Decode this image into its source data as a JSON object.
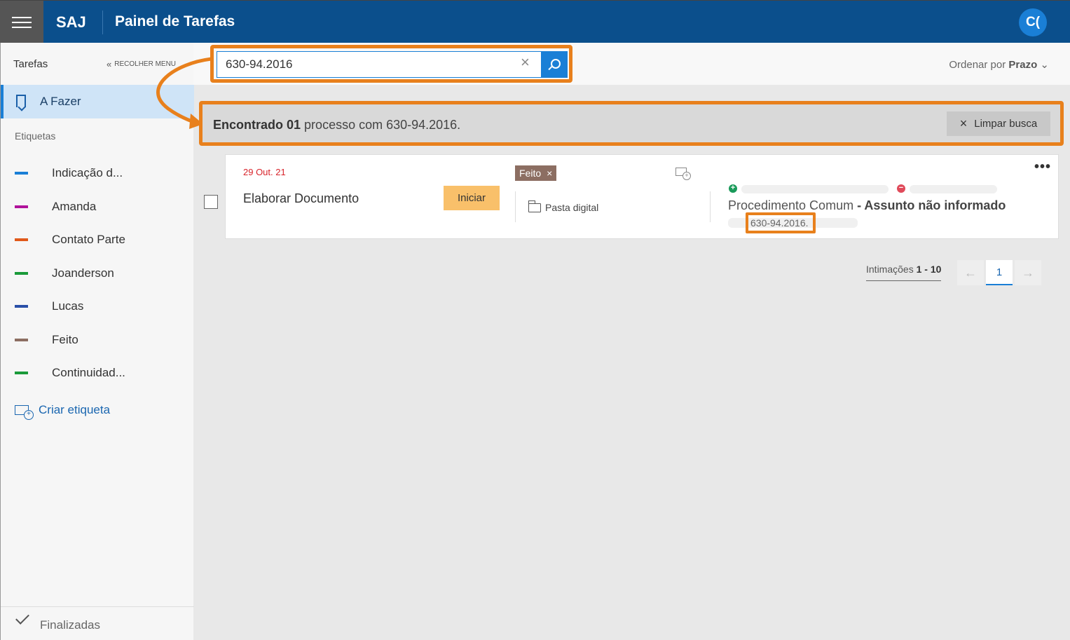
{
  "header": {
    "brand": "SAJ",
    "title": "Painel de Tarefas",
    "avatar_initials": "C("
  },
  "sidebar": {
    "heading": "Tarefas",
    "collapse_label": "RECOLHER MENU",
    "active_item": "A Fazer",
    "labels_heading": "Etiquetas",
    "tags": [
      {
        "label": "Indicação d...",
        "color": "#1a7fd6"
      },
      {
        "label": "Amanda",
        "color": "#b0139a"
      },
      {
        "label": "Contato Parte",
        "color": "#e0591a"
      },
      {
        "label": "Joanderson",
        "color": "#1a9a3a"
      },
      {
        "label": "Lucas",
        "color": "#2a4fa8"
      },
      {
        "label": "Feito",
        "color": "#8c6e62"
      },
      {
        "label": "Continuidad...",
        "color": "#1a9a3a"
      }
    ],
    "create_tag": "Criar etiqueta",
    "finalized": "Finalizadas"
  },
  "toolbar": {
    "search_value": "630-94.2016",
    "sort_prefix": "Ordenar por",
    "sort_value": "Prazo"
  },
  "result": {
    "found_bold": "Encontrado 01",
    "found_rest": "processo com 630-94.2016.",
    "clear_label": "Limpar busca"
  },
  "task": {
    "due": "29 Out. 21",
    "title": "Elaborar Documento",
    "start_label": "Iniciar",
    "tag": "Feito",
    "folder_label": "Pasta digital",
    "procedure": "Procedimento Comum",
    "subject": "Assunto não informado",
    "process_number": "630-94.2016."
  },
  "pagination": {
    "label": "Intimações",
    "range": "1 - 10",
    "current_page": "1"
  },
  "colors": {
    "header_bg": "#0b4f8c",
    "accent": "#1a7fd6",
    "highlight": "#e8801c",
    "start_button": "#f9c06a"
  }
}
